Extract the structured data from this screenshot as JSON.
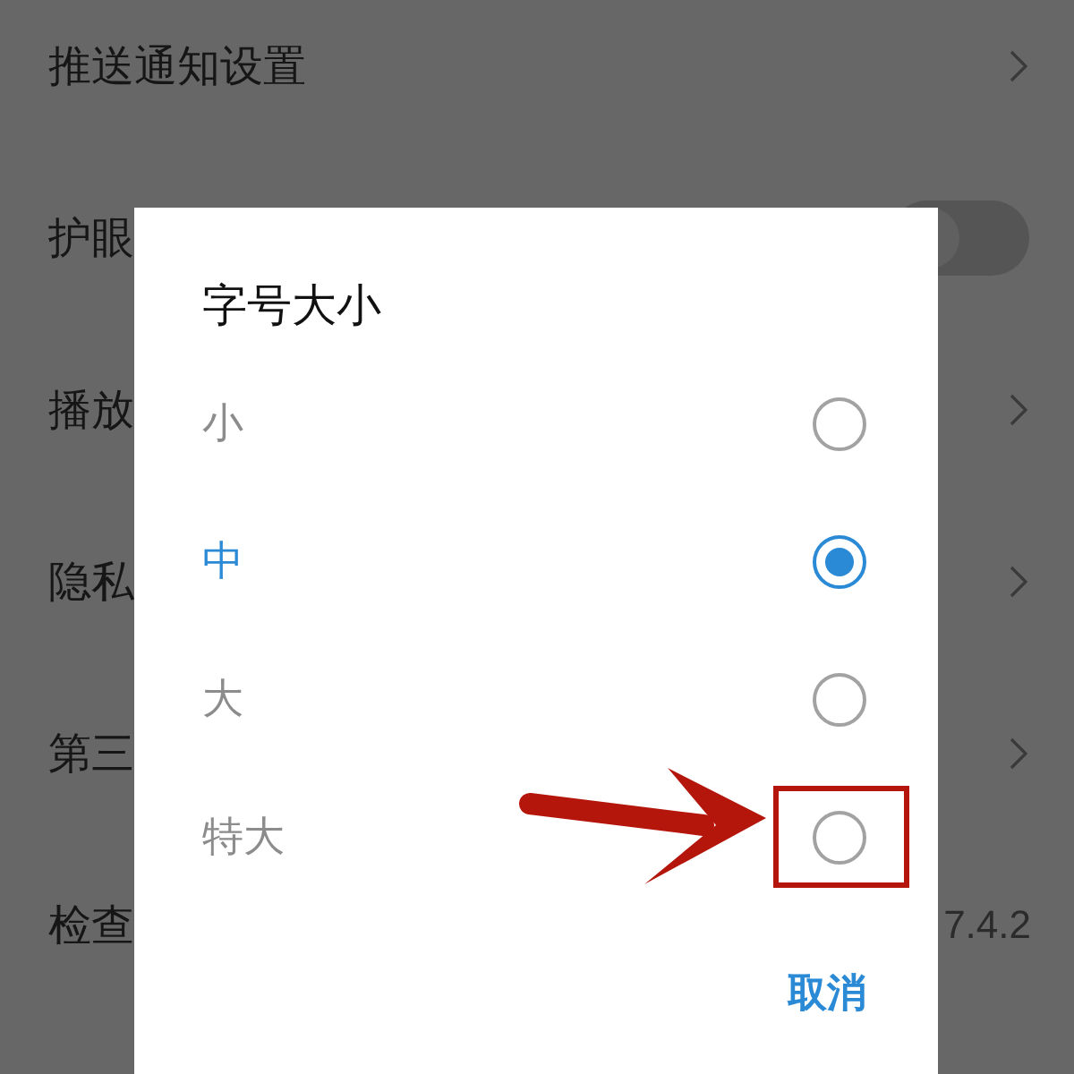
{
  "settings": [
    {
      "kind": "link",
      "label": "推送通知设置"
    },
    {
      "kind": "toggle",
      "label": "护眼",
      "on": false
    },
    {
      "kind": "link",
      "label": "播放"
    },
    {
      "kind": "link",
      "label": "隐私"
    },
    {
      "kind": "link",
      "label": "第三"
    },
    {
      "kind": "value",
      "label": "检查",
      "value": "7.4.2"
    }
  ],
  "dialog": {
    "title": "字号大小",
    "options": [
      {
        "label": "小",
        "selected": false,
        "highlighted": false
      },
      {
        "label": "中",
        "selected": true,
        "highlighted": false
      },
      {
        "label": "大",
        "selected": false,
        "highlighted": false
      },
      {
        "label": "特大",
        "selected": false,
        "highlighted": true
      }
    ],
    "cancel": "取消"
  }
}
